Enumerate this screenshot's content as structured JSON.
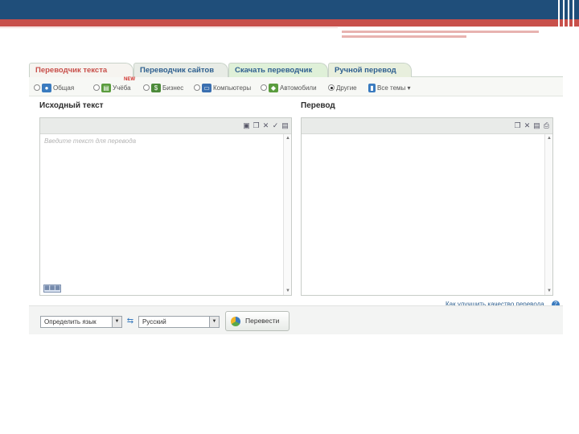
{
  "tabs": [
    {
      "label": "Переводчик текста"
    },
    {
      "label": "Переводчик сайтов"
    },
    {
      "label": "Скачать переводчик"
    },
    {
      "label": "Ручной перевод"
    }
  ],
  "topics": [
    {
      "label": "Общая",
      "icon": "globe-icon"
    },
    {
      "label": "Учёба",
      "icon": "book-icon"
    },
    {
      "label": "Бизнес",
      "icon": "money-icon"
    },
    {
      "label": "Компьютеры",
      "icon": "computer-icon"
    },
    {
      "label": "Автомобили",
      "icon": "car-icon"
    },
    {
      "label": "Другие",
      "icon": "chart-icon",
      "selected": true
    },
    {
      "label": "Все темы ▾",
      "icon": "bars-icon"
    }
  ],
  "new_badge": "NEW",
  "source": {
    "title": "Исходный текст",
    "placeholder": "Введите текст для перевода"
  },
  "target": {
    "title": "Перевод"
  },
  "improve_link": "Как улучшить качество перевода",
  "keyboard_label": "▦▦▦",
  "bottom": {
    "from_lang": "Определить язык",
    "to_lang": "Русский",
    "translate_label": "Перевести"
  },
  "colors": {
    "accent_red": "#c8504b",
    "link_blue": "#2e5f8f",
    "header_blue": "#1f4e7a"
  }
}
